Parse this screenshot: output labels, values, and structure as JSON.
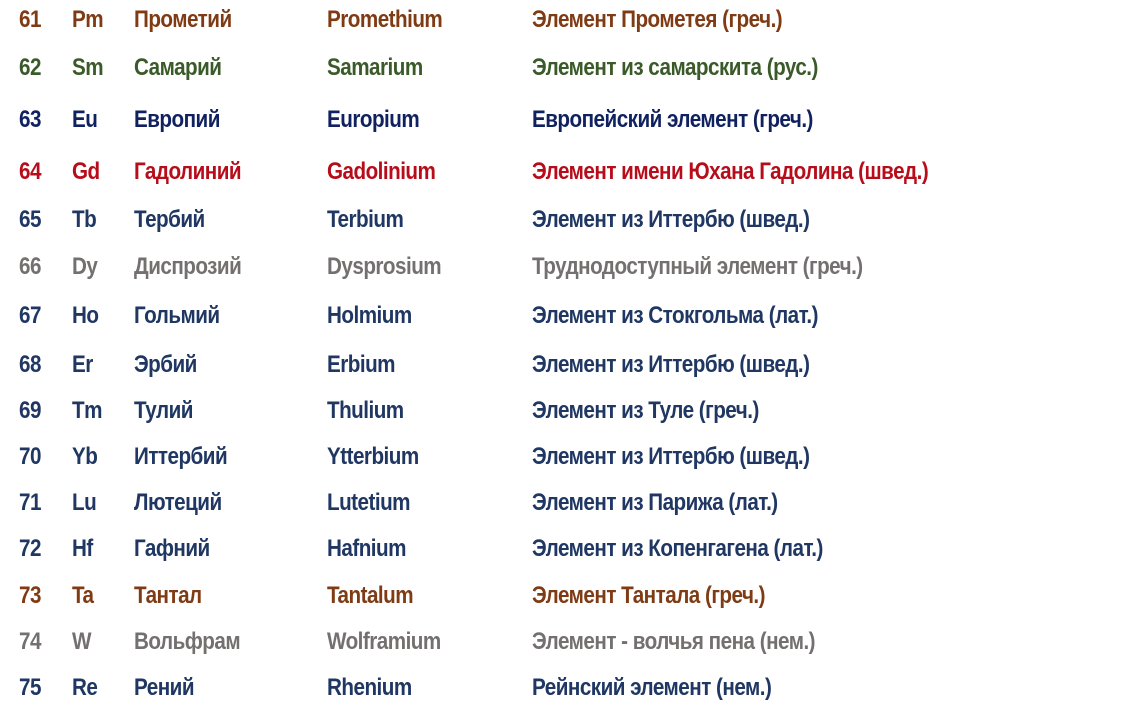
{
  "colors": {
    "brown": "#7f3b14",
    "green": "#3b5a2a",
    "navy_deep": "#10215f",
    "red": "#b70d1b",
    "navy": "#1f3762",
    "gray": "#747070"
  },
  "elements": [
    {
      "number": "61",
      "symbol": "Pm",
      "name_ru": "Прометий",
      "name_la": "Promethium",
      "etymology": "Элемент Прометея (греч.)",
      "color": "#7f3b14"
    },
    {
      "number": "62",
      "symbol": "Sm",
      "name_ru": "Самарий",
      "name_la": "Samarium",
      "etymology": "Элемент из самарскита (рус.)",
      "color": "#3b5a2a"
    },
    {
      "number": "63",
      "symbol": "Eu",
      "name_ru": "Европий",
      "name_la": "Europium",
      "etymology": "Европейский элемент (греч.)",
      "color": "#10215f"
    },
    {
      "number": "64",
      "symbol": "Gd",
      "name_ru": "Гадолиний",
      "name_la": "Gadolinium",
      "etymology": "Элемент имени Юхана Гадолина (швед.)",
      "color": "#b70d1b"
    },
    {
      "number": "65",
      "symbol": "Tb",
      "name_ru": "Тербий",
      "name_la": "Terbium",
      "etymology": "Элемент из Иттербю (швед.)",
      "color": "#1f3762"
    },
    {
      "number": "66",
      "symbol": "Dy",
      "name_ru": "Диспрозий",
      "name_la": "Dysprosium",
      "etymology": "Труднодоступный элемент (греч.)",
      "color": "#747070"
    },
    {
      "number": "67",
      "symbol": "Ho",
      "name_ru": "Гольмий",
      "name_la": "Holmium",
      "etymology": "Элемент из Стокгольма (лат.)",
      "color": "#1f3762"
    },
    {
      "number": "68",
      "symbol": "Er",
      "name_ru": "Эрбий",
      "name_la": "Erbium",
      "etymology": "Элемент из Иттербю (швед.)",
      "color": "#1f3762"
    },
    {
      "number": "69",
      "symbol": "Tm",
      "name_ru": "Тулий",
      "name_la": "Thulium",
      "etymology": "Элемент из Туле (греч.)",
      "color": "#1f3762"
    },
    {
      "number": "70",
      "symbol": "Yb",
      "name_ru": "Иттербий",
      "name_la": "Ytterbium",
      "etymology": "Элемент из Иттербю (швед.)",
      "color": "#1f3762"
    },
    {
      "number": "71",
      "symbol": "Lu",
      "name_ru": "Лютеций",
      "name_la": "Lutetium",
      "etymology": "Элемент из Парижа (лат.)",
      "color": "#1f3762"
    },
    {
      "number": "72",
      "symbol": "Hf",
      "name_ru": "Гафний",
      "name_la": "Hafnium",
      "etymology": "Элемент из Копенгагена (лат.)",
      "color": "#1f3762"
    },
    {
      "number": "73",
      "symbol": "Ta",
      "name_ru": "Тантал",
      "name_la": "Tantalum",
      "etymology": "Элемент Тантала (греч.)",
      "color": "#7f3b14"
    },
    {
      "number": "74",
      "symbol": "W",
      "name_ru": "Вольфрам",
      "name_la": "Wolframium",
      "etymology": "Элемент - волчья пена (нем.)",
      "color": "#747070"
    },
    {
      "number": "75",
      "symbol": "Re",
      "name_ru": "Рений",
      "name_la": "Rhenium",
      "etymology": "Рейнский элемент (нем.)",
      "color": "#1f3762"
    }
  ]
}
